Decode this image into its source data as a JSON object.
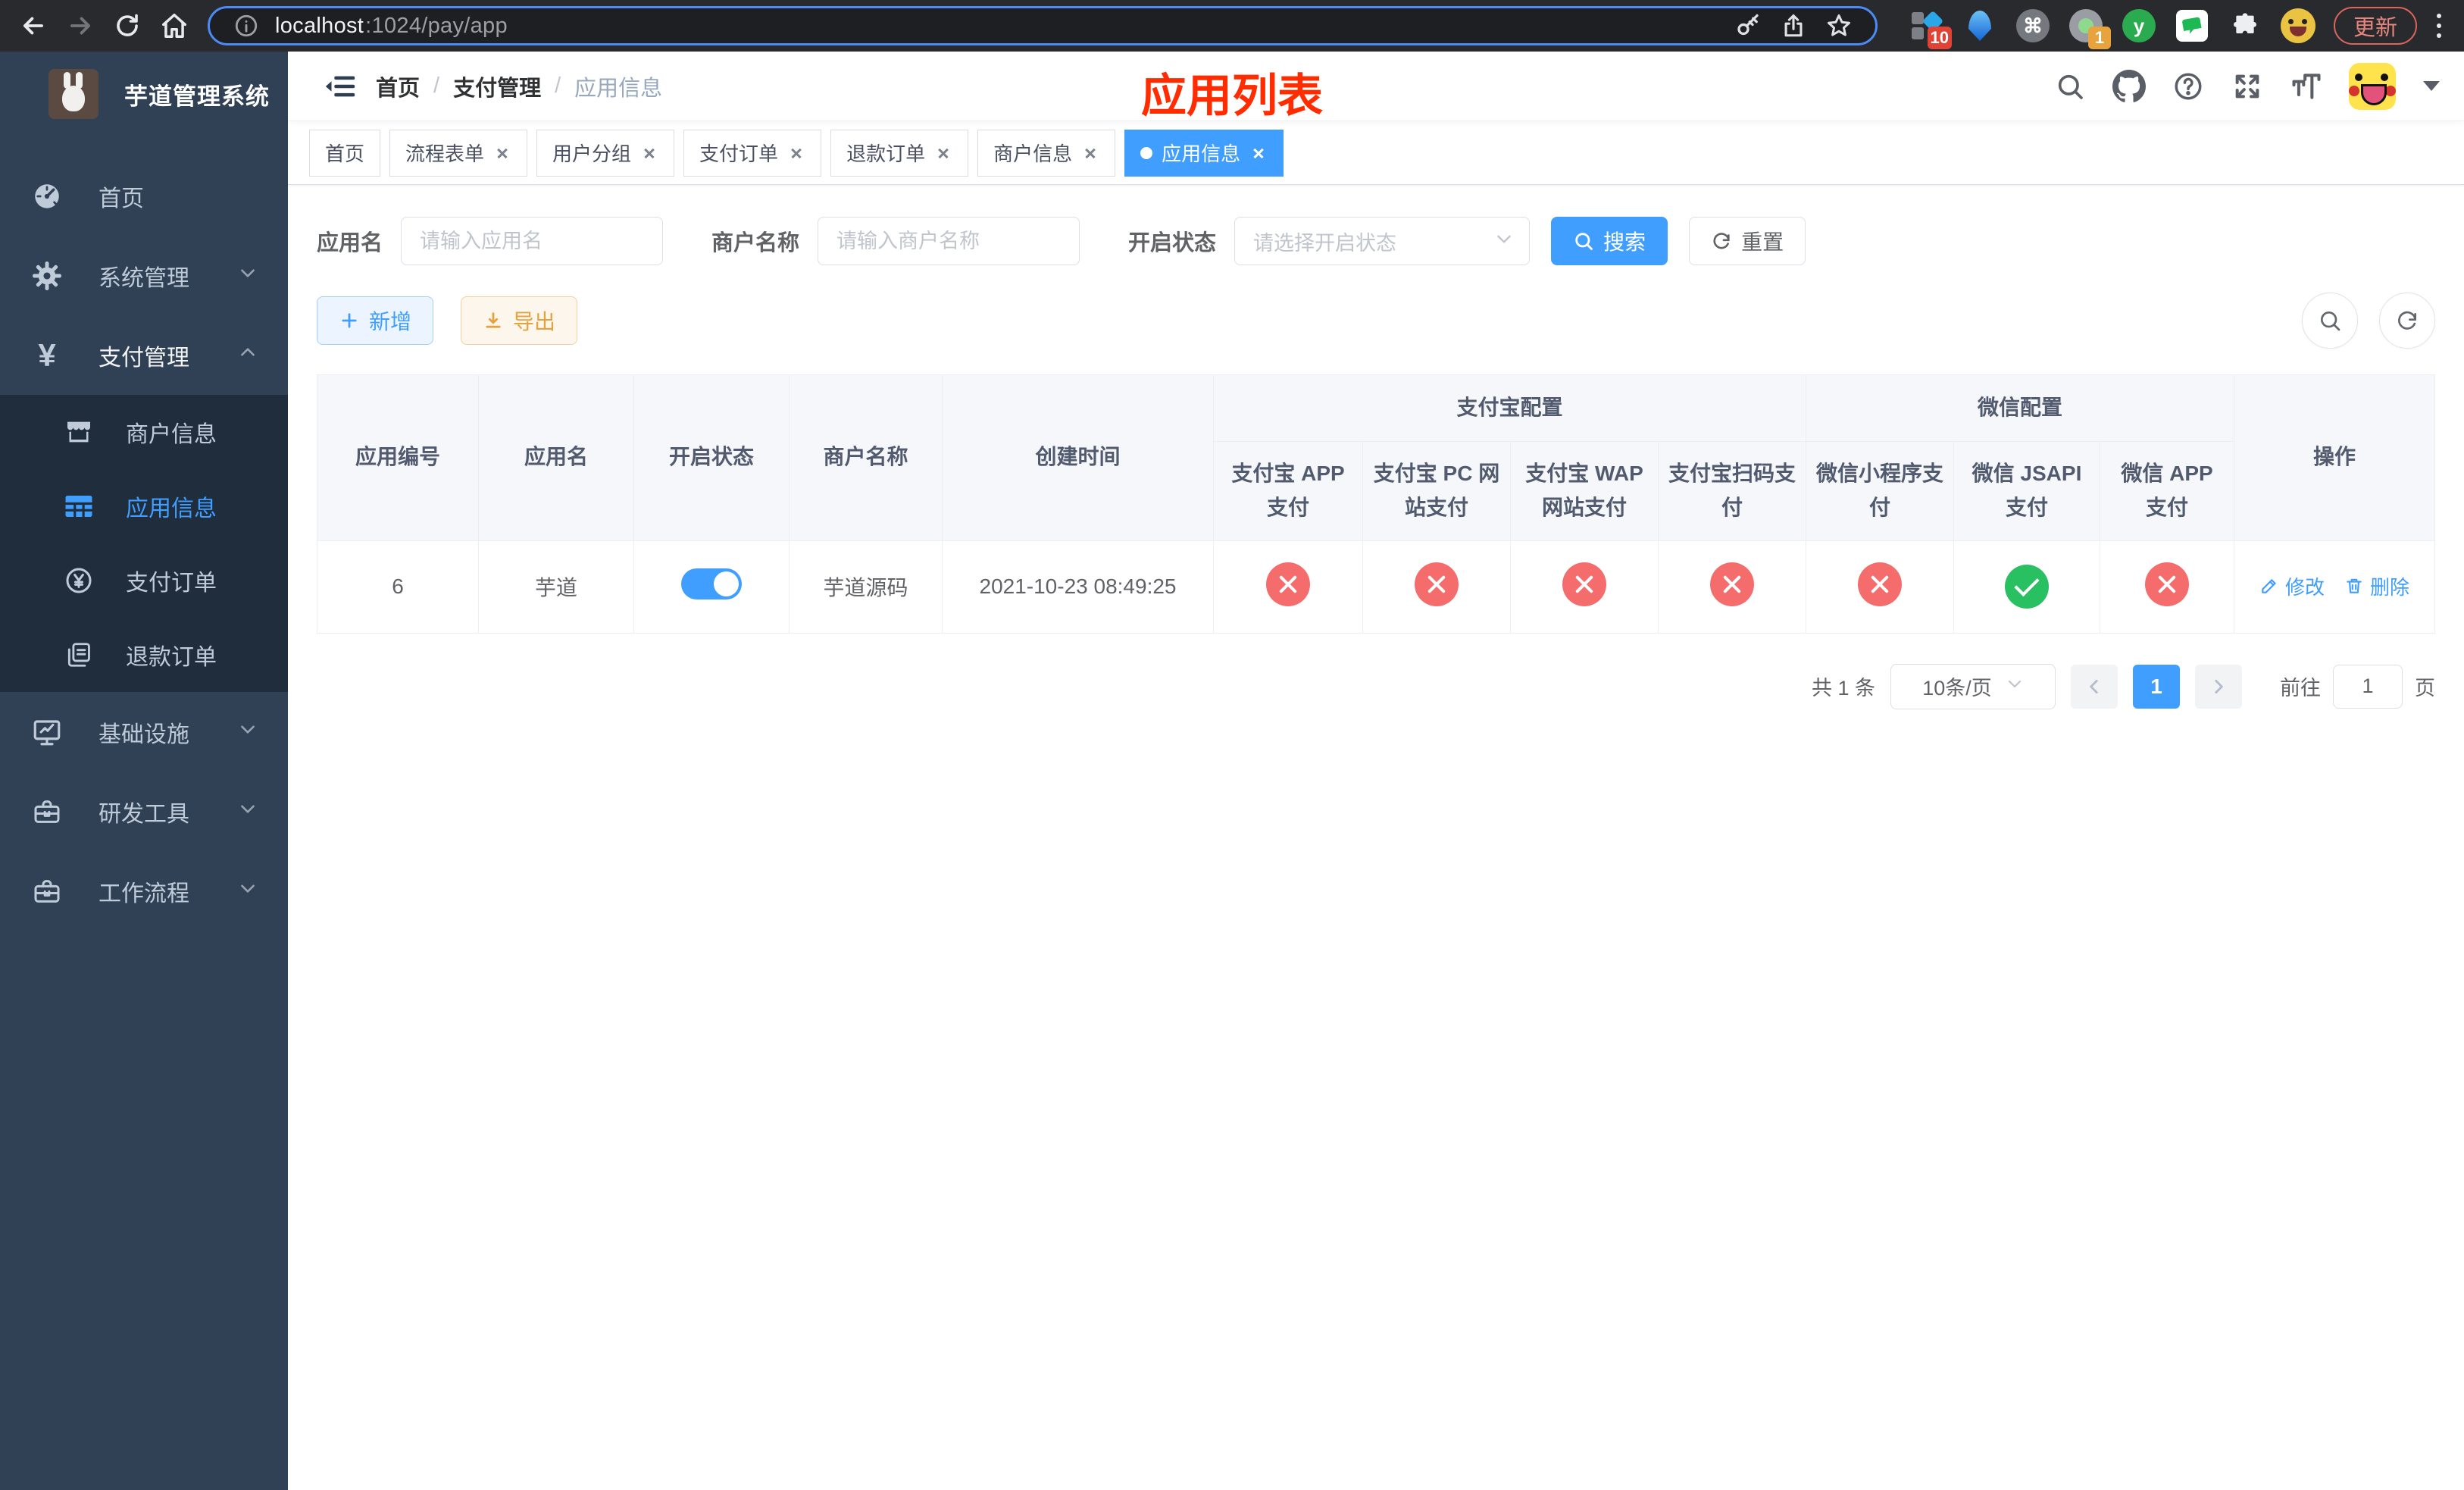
{
  "colors": {
    "primary": "#409eff",
    "danger": "#f56c6c",
    "success": "#29c061",
    "warning": "#e6a23c",
    "sidebar_bg": "#304156",
    "submenu_bg": "#1f2d3d",
    "overlay_title_red": "#ff2c00"
  },
  "browser": {
    "url_host": "localhost",
    "url_rest": ":1024/pay/app",
    "update_label": "更新",
    "ext_badge_tiles": "10",
    "ext_badge_record": "1",
    "ext_y_glyph": "y",
    "ext_cmd_glyph": "⌘"
  },
  "sidebar": {
    "title": "芋道管理系统",
    "items": [
      {
        "label": "首页"
      },
      {
        "label": "系统管理"
      },
      {
        "label": "支付管理"
      },
      {
        "label": "商户信息"
      },
      {
        "label": "应用信息"
      },
      {
        "label": "支付订单"
      },
      {
        "label": "退款订单"
      },
      {
        "label": "基础设施"
      },
      {
        "label": "研发工具"
      },
      {
        "label": "工作流程"
      }
    ]
  },
  "breadcrumb": {
    "items": [
      "首页",
      "支付管理",
      "应用信息"
    ],
    "separator": "/"
  },
  "overlay_title": "应用列表",
  "tabs": [
    {
      "label": "首页"
    },
    {
      "label": "流程表单"
    },
    {
      "label": "用户分组"
    },
    {
      "label": "支付订单"
    },
    {
      "label": "退款订单"
    },
    {
      "label": "商户信息"
    },
    {
      "label": "应用信息"
    }
  ],
  "search": {
    "app_name_label": "应用名",
    "app_name_placeholder": "请输入应用名",
    "merchant_label": "商户名称",
    "merchant_placeholder": "请输入商户名称",
    "status_label": "开启状态",
    "status_placeholder": "请选择开启状态",
    "search_label": "搜索",
    "reset_label": "重置"
  },
  "toolbar": {
    "add_label": "新增",
    "export_label": "导出"
  },
  "table": {
    "headers": {
      "app_id": "应用编号",
      "app_name": "应用名",
      "status": "开启状态",
      "merchant": "商户名称",
      "created": "创建时间",
      "alipay_group": "支付宝配置",
      "wechat_group": "微信配置",
      "alipay_app": "支付宝 APP 支付",
      "alipay_pc": "支付宝 PC 网站支付",
      "alipay_wap": "支付宝 WAP 网站支付",
      "alipay_qr": "支付宝扫码支付",
      "wx_mini": "微信小程序支付",
      "wx_jsapi": "微信 JSAPI 支付",
      "wx_app": "微信 APP 支付",
      "actions": "操作"
    },
    "rows": [
      {
        "id": "6",
        "name": "芋道",
        "enabled": true,
        "merchant": "芋道源码",
        "created": "2021-10-23 08:49:25",
        "statuses": [
          "no",
          "no",
          "no",
          "no",
          "no",
          "yes",
          "no"
        ],
        "edit_label": "修改",
        "delete_label": "删除"
      }
    ]
  },
  "pagination": {
    "total": "共 1 条",
    "page_size": "10条/页",
    "page": "1",
    "goto_label": "前往",
    "goto_value": "1",
    "unit": "页"
  }
}
